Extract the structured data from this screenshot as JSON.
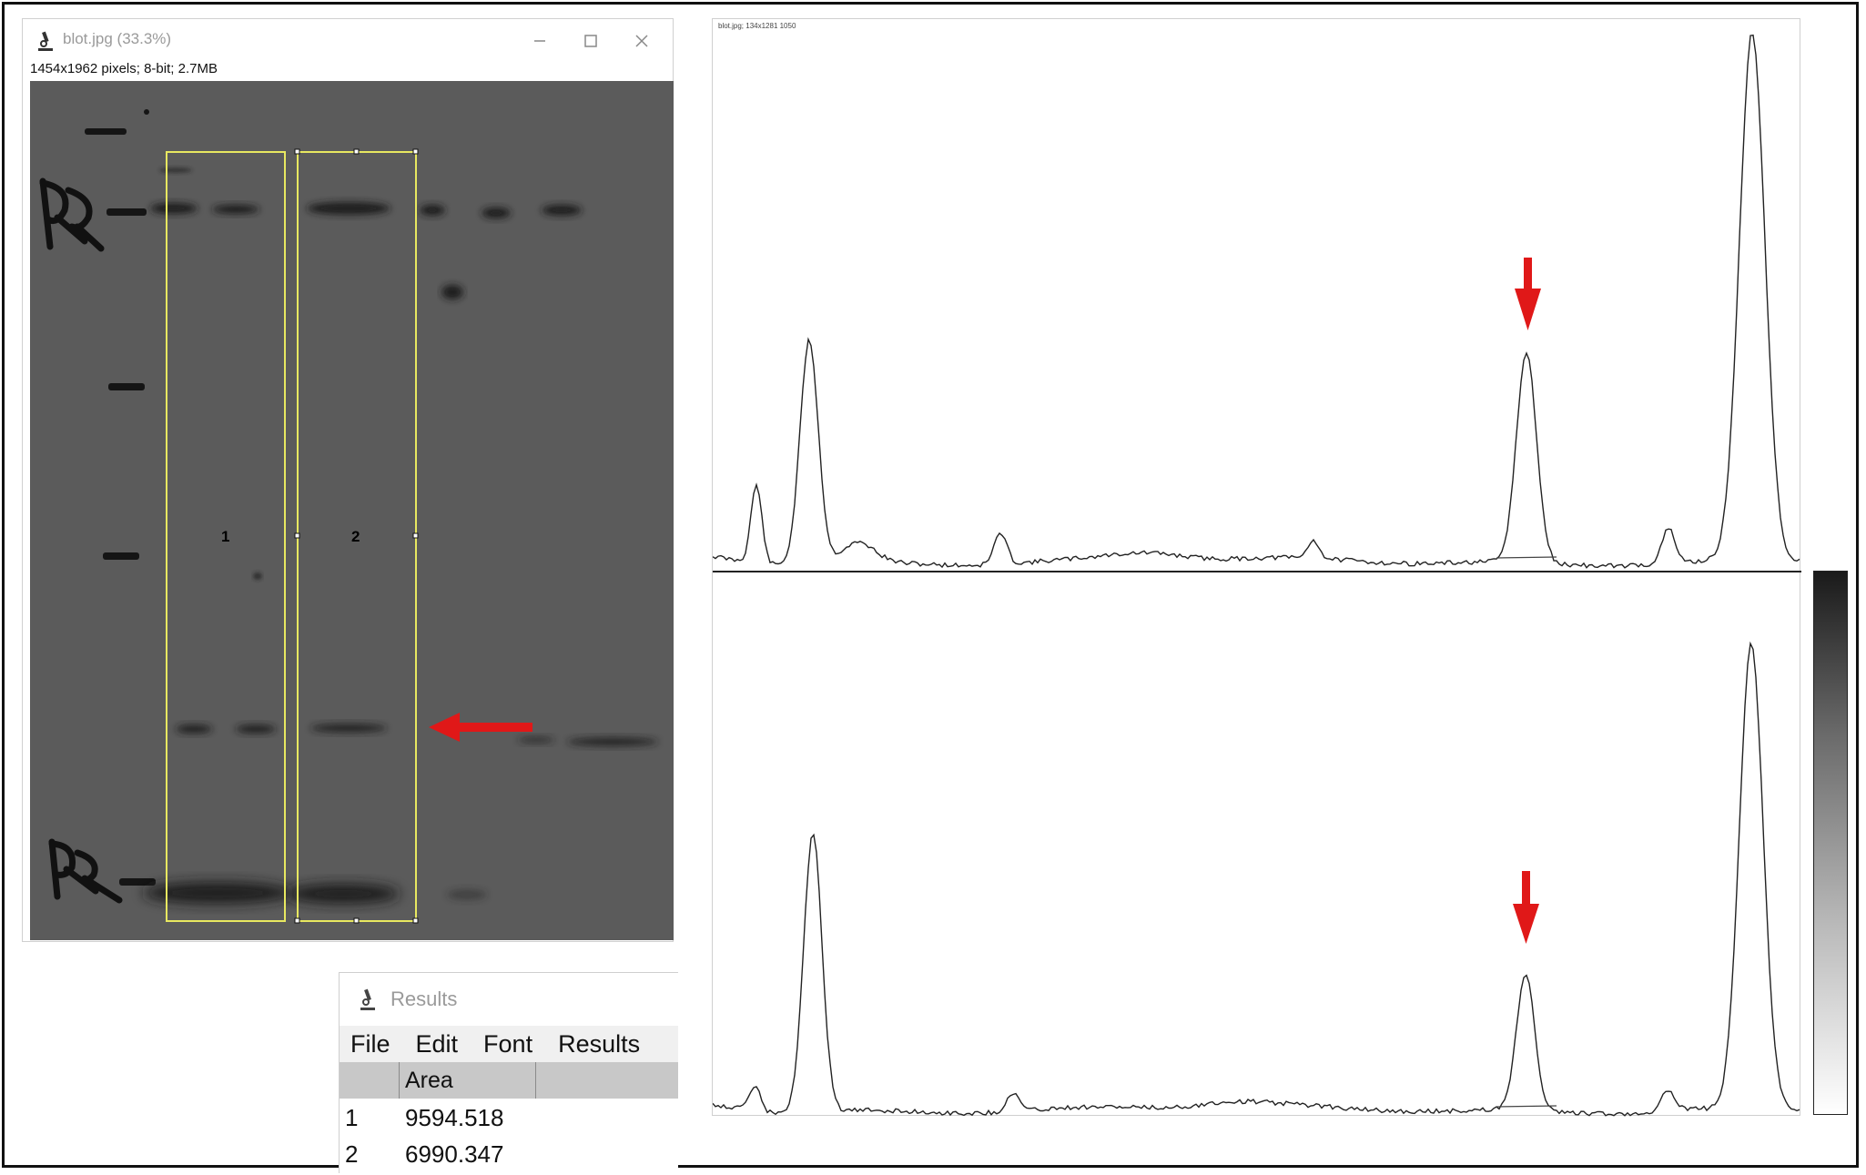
{
  "image_window": {
    "title": "blot.jpg (33.3%)",
    "info": "1454x1962 pixels; 8-bit; 2.7MB",
    "roi_labels": [
      "1",
      "2"
    ],
    "icons": {
      "app": "imagej-microscope-icon",
      "minimize": "minimize-icon",
      "maximize": "maximize-icon",
      "close": "close-icon"
    }
  },
  "results_window": {
    "title": "Results",
    "menu": [
      "File",
      "Edit",
      "Font",
      "Results"
    ],
    "columns": [
      "",
      "Area"
    ],
    "rows": [
      {
        "index": "1",
        "area": "9594.518"
      },
      {
        "index": "2",
        "area": "6990.347"
      }
    ]
  },
  "profile_plot": {
    "caption": "blot.jpg; 134x1281 1050"
  },
  "colors": {
    "roi": "#e8e860",
    "arrow": "#e01818",
    "blot_bg": "#5b5b5b",
    "plot_line": "#222222"
  }
}
